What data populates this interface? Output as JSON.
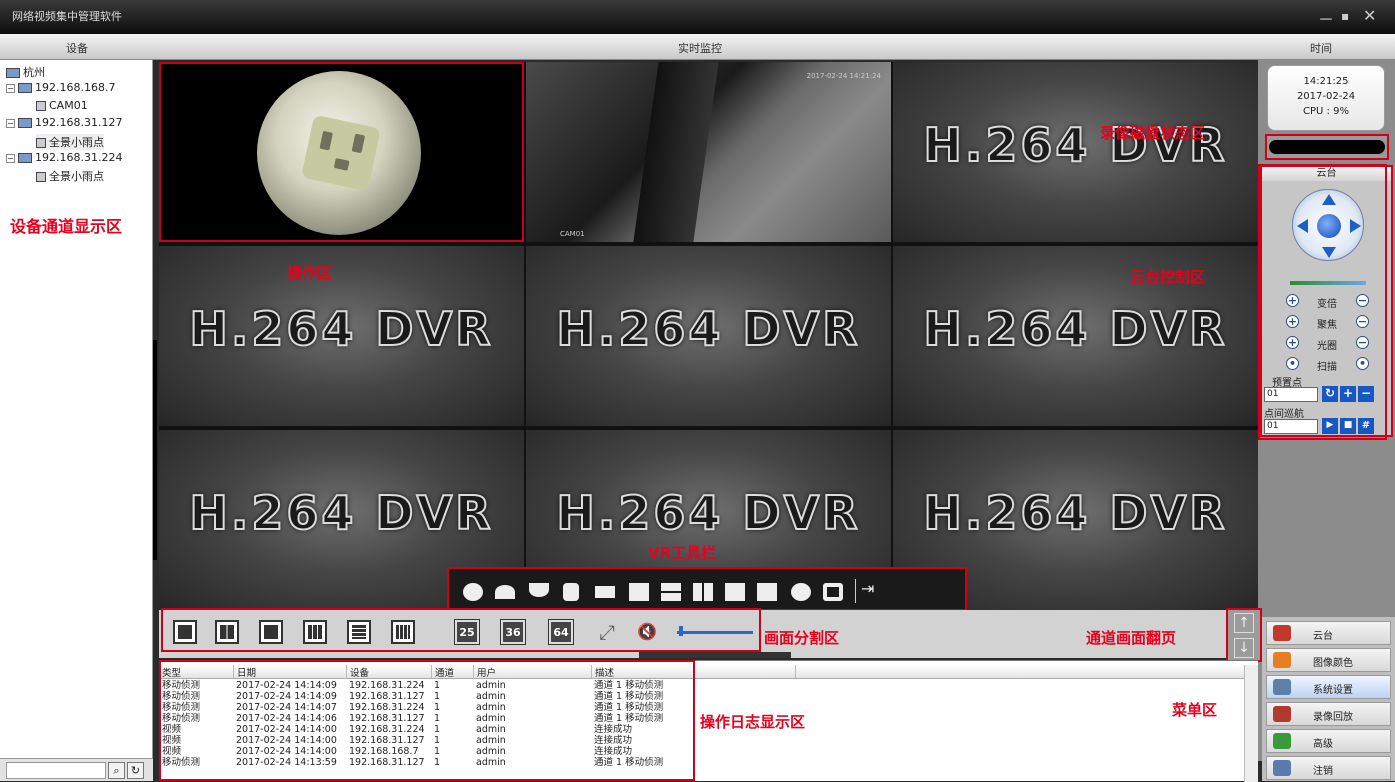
{
  "window": {
    "title": "网络视频集中管理软件",
    "controls": [
      "－",
      "▪",
      "✕"
    ]
  },
  "header": {
    "device": "设备",
    "live": "实时监控",
    "time": "时间"
  },
  "tree": [
    {
      "label": "杭州",
      "level": 0,
      "kind": "group"
    },
    {
      "label": "192.168.168.7",
      "level": 1,
      "kind": "device"
    },
    {
      "label": "CAM01",
      "level": 2,
      "kind": "channel"
    },
    {
      "label": "192.168.31.127",
      "level": 1,
      "kind": "device"
    },
    {
      "label": "全景小雨点",
      "level": 2,
      "kind": "channel"
    },
    {
      "label": "192.168.31.224",
      "level": 1,
      "kind": "device"
    },
    {
      "label": "全景小雨点",
      "level": 2,
      "kind": "channel"
    }
  ],
  "video": {
    "placeholder": "H.264 DVR",
    "cam2_timestamp": "2017-02-24 14:21:24",
    "cam2_name": "CAM01"
  },
  "annotations": {
    "device_area": "设备通道显示区",
    "operation_area": "操作区",
    "disk_status": "录像磁盘状态区",
    "ptz_area": "云台控制区",
    "vr_toolbar": "VR工具栏",
    "split_area": "画面分割区",
    "page_flip": "通道画面翻页",
    "log_area": "操作日志显示区",
    "menu_area": "菜单区"
  },
  "clock": {
    "time": "14:21:25",
    "date": "2017-02-24",
    "cpu": "CPU : 9%"
  },
  "ptz": {
    "title": "云台",
    "rows": [
      "变倍",
      "聚焦",
      "光圈",
      "扫描"
    ],
    "preset_label": "预置点",
    "preset_value": "01",
    "cruise_label": "点间巡航",
    "cruise_value": "01"
  },
  "split": {
    "labels": [
      "25",
      "36",
      "64"
    ]
  },
  "menu": {
    "items": [
      {
        "label": "云台",
        "color": "#c0392b"
      },
      {
        "label": "图像颜色",
        "color": "#e67e22"
      },
      {
        "label": "系统设置",
        "color": "#5d7fa8"
      },
      {
        "label": "录像回放",
        "color": "#b03a2e"
      },
      {
        "label": "高级",
        "color": "#3a9a3a"
      },
      {
        "label": "注销",
        "color": "#5a7ab0"
      }
    ]
  },
  "log": {
    "headers": [
      "类型",
      "日期",
      "设备",
      "通道",
      "用户",
      "描述"
    ],
    "rows": [
      [
        "移动侦测",
        "2017-02-24 14:14:09",
        "192.168.31.224",
        "1",
        "admin",
        "通道 1 移动侦测"
      ],
      [
        "移动侦测",
        "2017-02-24 14:14:09",
        "192.168.31.127",
        "1",
        "admin",
        "通道 1 移动侦测"
      ],
      [
        "移动侦测",
        "2017-02-24 14:14:07",
        "192.168.31.224",
        "1",
        "admin",
        "通道 1 移动侦测"
      ],
      [
        "移动侦测",
        "2017-02-24 14:14:06",
        "192.168.31.127",
        "1",
        "admin",
        "通道 1 移动侦测"
      ],
      [
        "视频",
        "2017-02-24 14:14:00",
        "192.168.31.224",
        "1",
        "admin",
        "连接成功"
      ],
      [
        "视频",
        "2017-02-24 14:14:00",
        "192.168.31.127",
        "1",
        "admin",
        "连接成功"
      ],
      [
        "视频",
        "2017-02-24 14:14:00",
        "192.168.168.7",
        "1",
        "admin",
        "连接成功"
      ],
      [
        "移动侦测",
        "2017-02-24 14:13:59",
        "192.168.31.127",
        "1",
        "admin",
        "通道 1 移动侦测"
      ]
    ]
  }
}
